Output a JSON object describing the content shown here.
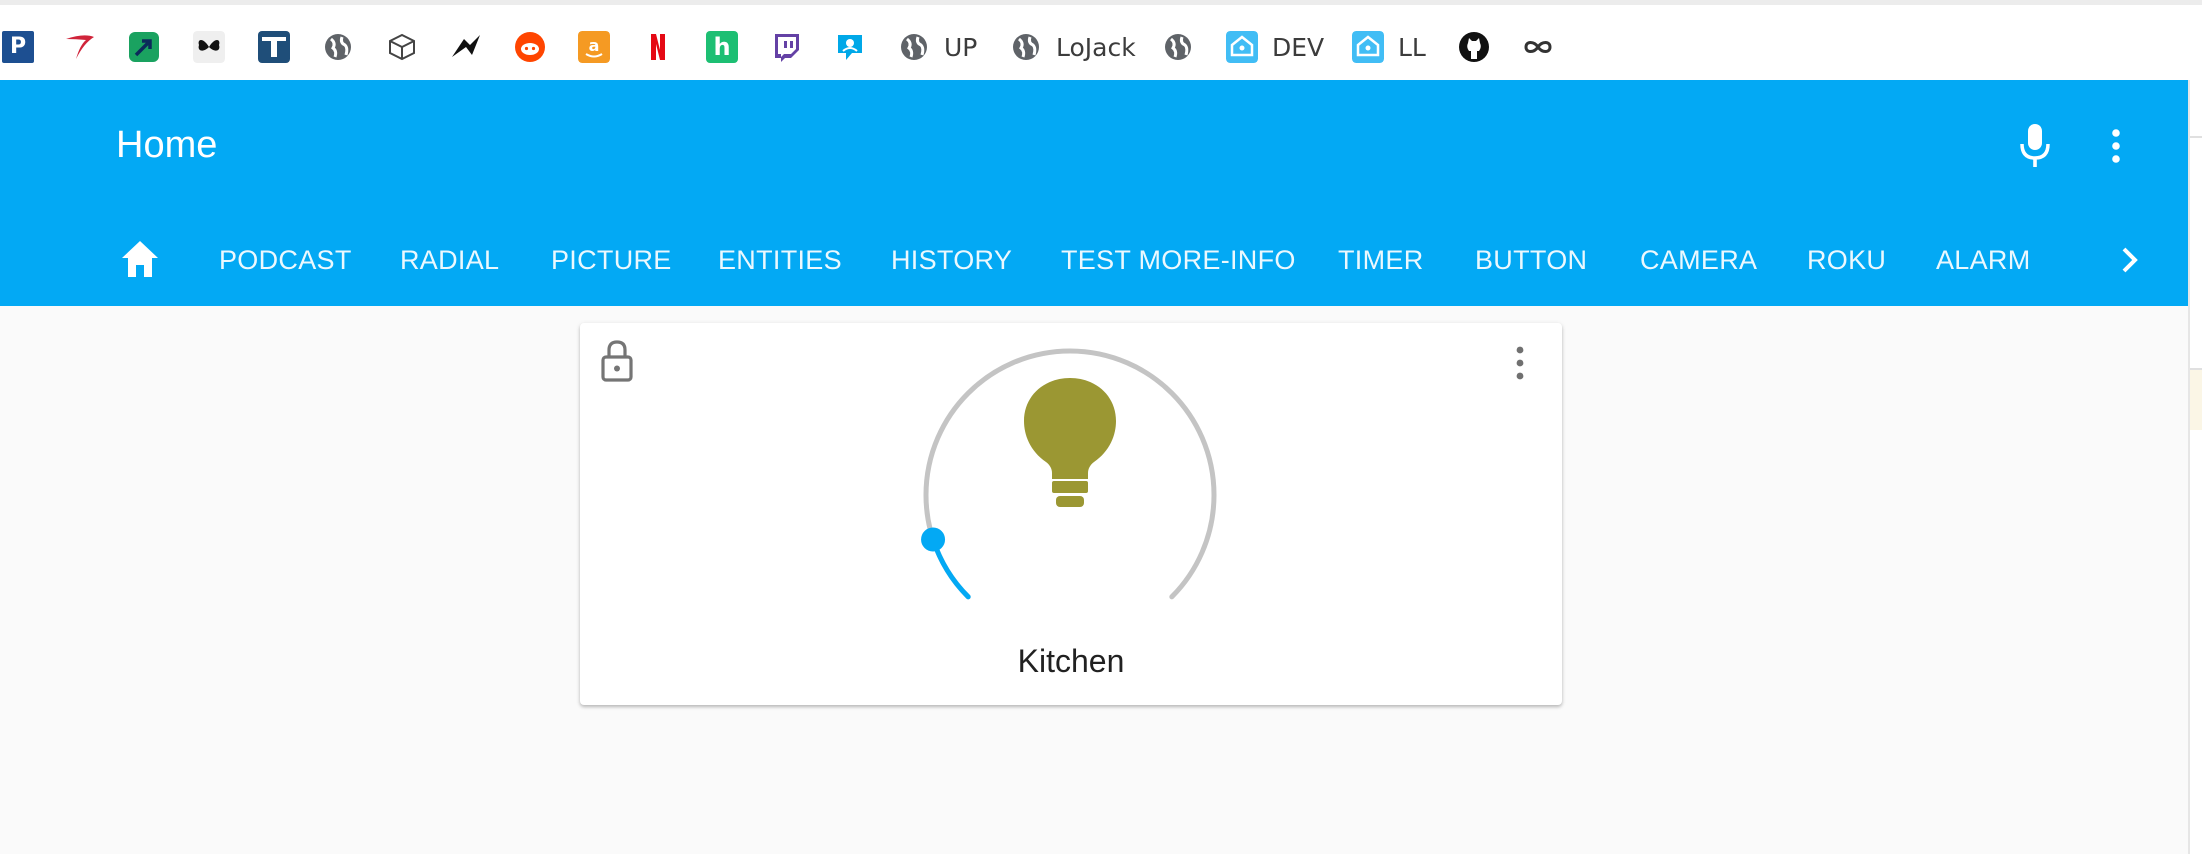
{
  "bookmarks": {
    "items": [
      {
        "icon": "p-logo-icon",
        "label": ""
      },
      {
        "icon": "red-swoosh-icon",
        "label": ""
      },
      {
        "icon": "green-arrow-icon",
        "label": ""
      },
      {
        "icon": "butterfly-icon",
        "label": ""
      },
      {
        "icon": "t-logo-icon",
        "label": ""
      },
      {
        "icon": "globe-icon",
        "label": ""
      },
      {
        "icon": "box-icon",
        "label": ""
      },
      {
        "icon": "bird-icon",
        "label": ""
      },
      {
        "icon": "reddit-icon",
        "label": ""
      },
      {
        "icon": "amazon-icon",
        "label": ""
      },
      {
        "icon": "netflix-icon",
        "label": ""
      },
      {
        "icon": "h-logo-icon",
        "label": ""
      },
      {
        "icon": "twitch-icon",
        "label": ""
      },
      {
        "icon": "chat-bubble-icon",
        "label": ""
      },
      {
        "icon": "globe-icon",
        "label": "UP"
      },
      {
        "icon": "globe-icon",
        "label": "LoJack"
      },
      {
        "icon": "globe-icon",
        "label": ""
      },
      {
        "icon": "home-assistant-icon",
        "label": "DEV"
      },
      {
        "icon": "home-assistant-icon",
        "label": "LL"
      },
      {
        "icon": "github-icon",
        "label": ""
      },
      {
        "icon": "infinity-icon",
        "label": ""
      }
    ]
  },
  "header": {
    "title": "Home",
    "mic_icon": "microphone-icon",
    "menu_icon": "more-vert-icon",
    "background": "#03a9f4"
  },
  "tabs": {
    "home_icon": "home-icon",
    "items": [
      "PODCAST",
      "RADIAL",
      "PICTURE",
      "ENTITIES",
      "HISTORY",
      "TEST MORE-INFO",
      "TIMER",
      "BUTTON",
      "CAMERA",
      "ROKU",
      "ALARM"
    ],
    "scroll_icon": "chevron-right-icon"
  },
  "card": {
    "name": "Kitchen",
    "lock_icon": "lock-icon",
    "menu_icon": "more-vert-icon",
    "bulb_icon": "lightbulb-icon",
    "brightness_fraction": 0.1,
    "bulb_color": "#9b9733",
    "slider_color": "#03a9f4",
    "track_color": "#c4c4c4"
  }
}
